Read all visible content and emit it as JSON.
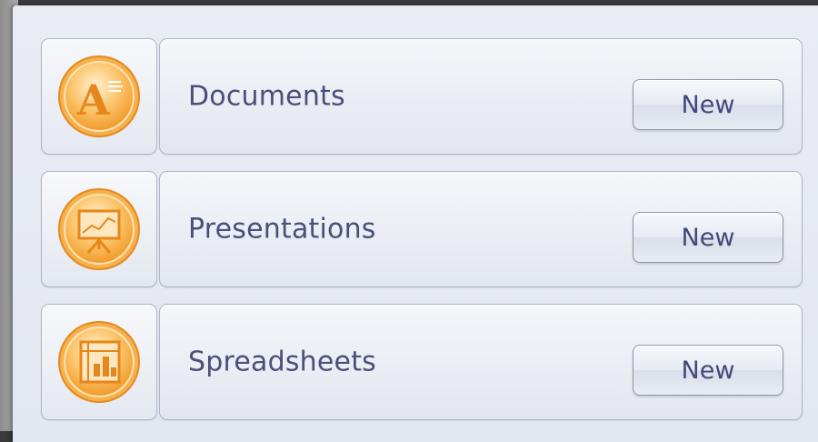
{
  "categories": [
    {
      "label": "Documents",
      "button_label": "New",
      "icon": "documents-app-icon"
    },
    {
      "label": "Presentations",
      "button_label": "New",
      "icon": "presentations-app-icon"
    },
    {
      "label": "Spreadsheets",
      "button_label": "New",
      "icon": "spreadsheets-app-icon"
    }
  ],
  "colors": {
    "label_text": "#4b4f7a",
    "icon_orange": "#f5a43a",
    "icon_orange_light": "#fde2b0",
    "panel_bg": "#e6e9f0"
  }
}
